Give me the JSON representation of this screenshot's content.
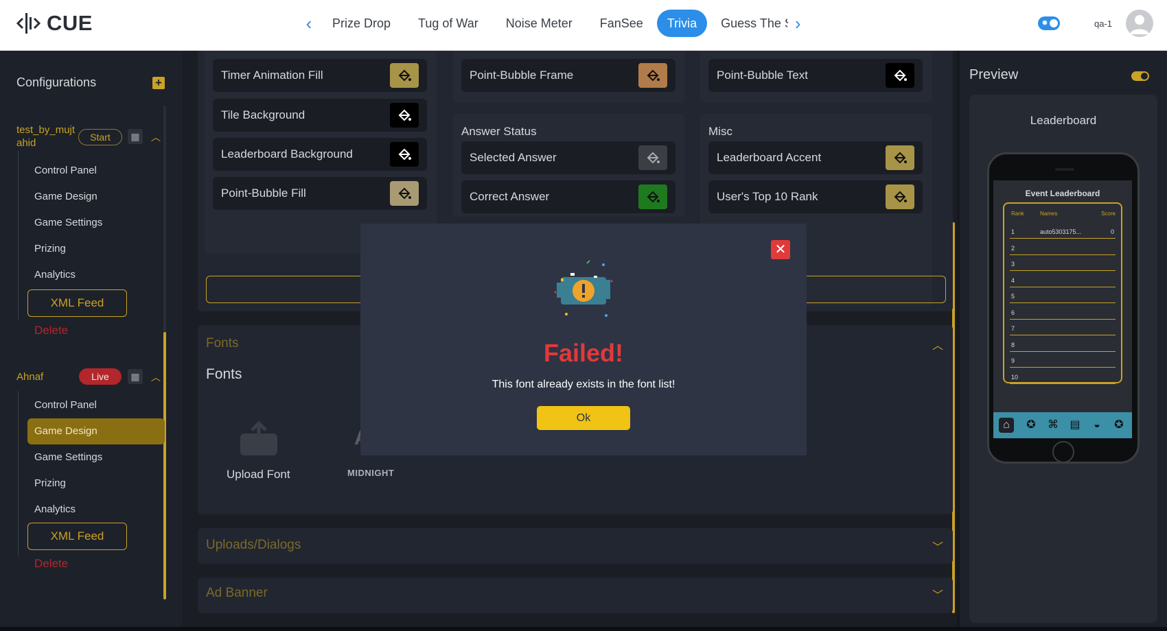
{
  "header": {
    "logo_text": "CUE",
    "nav_tabs": [
      {
        "label": "Prize Drop"
      },
      {
        "label": "Tug of War"
      },
      {
        "label": "Noise Meter"
      },
      {
        "label": "FanSee"
      },
      {
        "label": "Trivia",
        "active": true
      },
      {
        "label": "Guess The Sco"
      }
    ],
    "username": "qa-1"
  },
  "sidebar": {
    "title": "Configurations",
    "events": [
      {
        "name": "test_by_mujt ahid",
        "name_lines": [
          "test_by_mujt",
          "ahid"
        ],
        "status": "Start",
        "items": [
          "Control Panel",
          "Game Design",
          "Game Settings",
          "Prizing",
          "Analytics"
        ],
        "xml_feed": "XML Feed",
        "delete": "Delete"
      },
      {
        "name": "Ahnaf",
        "status": "Live",
        "items": [
          "Control Panel",
          "Game Design",
          "Game Settings",
          "Prizing",
          "Analytics"
        ],
        "active_item": "Game Design",
        "xml_feed": "XML Feed",
        "delete": "Delete"
      }
    ]
  },
  "colors": {
    "col1": [
      {
        "label": "Timer Animation Fill",
        "swatch": "#a79447"
      },
      {
        "label": "Tile Background",
        "swatch": "#000000"
      },
      {
        "label": "Leaderboard Background",
        "swatch": "#000000"
      },
      {
        "label": "Point-Bubble Fill",
        "swatch": "#a89a72"
      }
    ],
    "col2_top": {
      "label": "Point-Bubble Frame",
      "swatch": "#b17c4a"
    },
    "answer_status": {
      "title": "Answer Status",
      "rows": [
        {
          "label": "Selected Answer",
          "swatch": "#3b3e44"
        },
        {
          "label": "Correct Answer",
          "swatch": "#1e7a1e"
        }
      ]
    },
    "col3_top": {
      "label": "Point-Bubble Text",
      "swatch": "#000000"
    },
    "misc": {
      "title": "Misc",
      "rows": [
        {
          "label": "Leaderboard Accent",
          "swatch": "#a79447"
        },
        {
          "label": "User's Top 10 Rank",
          "swatch": "#a79447"
        }
      ]
    }
  },
  "fonts_section": {
    "title": "Fonts",
    "subtitle": "Fonts",
    "upload_label": "Upload Font",
    "font_sample_name": "MIDNIGHT",
    "font_sample_glyph": "AA"
  },
  "uploads_section": {
    "title": "Uploads/Dialogs"
  },
  "ad_banner_section": {
    "title": "Ad Banner"
  },
  "preview": {
    "title": "Preview",
    "subtitle": "Leaderboard",
    "leaderboard": {
      "title": "Event Leaderboard",
      "headers": [
        "Rank",
        "Names",
        "Score"
      ],
      "rows": [
        {
          "rank": "1",
          "name": "auto5303175...",
          "score": "0"
        },
        {
          "rank": "2",
          "name": "",
          "score": ""
        },
        {
          "rank": "3",
          "name": "",
          "score": ""
        },
        {
          "rank": "4",
          "name": "",
          "score": ""
        },
        {
          "rank": "5",
          "name": "",
          "score": ""
        },
        {
          "rank": "6",
          "name": "",
          "score": ""
        },
        {
          "rank": "7",
          "name": "",
          "score": ""
        },
        {
          "rank": "8",
          "name": "",
          "score": ""
        },
        {
          "rank": "9",
          "name": "",
          "score": ""
        },
        {
          "rank": "10",
          "name": "",
          "score": ""
        }
      ],
      "nav_home_label": "HOME"
    }
  },
  "modal": {
    "title": "Failed!",
    "message": "This font already exists in the font list!",
    "ok_label": "Ok"
  },
  "theme": {
    "accent": "#c9a227",
    "brand_blue": "#2b8ee8",
    "error_red": "#e03a3a"
  }
}
